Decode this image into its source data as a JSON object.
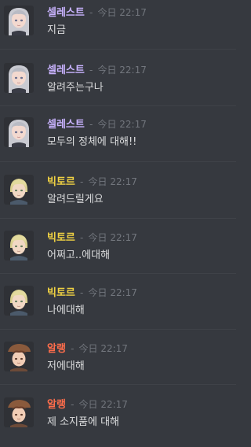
{
  "colors": {
    "background": "#36393f",
    "celeste_name": "#c9b3ff",
    "victor_name": "#f0d243",
    "alang_name": "#ff6d4b",
    "timestamp": "#72767d",
    "message_text": "#dcddde"
  },
  "messages": [
    {
      "name": "셀레스트",
      "sep": "-",
      "time": "今日 22:17",
      "text": "지금",
      "avatar": "celeste-avatar"
    },
    {
      "name": "셀레스트",
      "sep": "-",
      "time": "今日 22:17",
      "text": "알려주는구나",
      "avatar": "celeste-avatar"
    },
    {
      "name": "셀레스트",
      "sep": "-",
      "time": "今日 22:17",
      "text": "모두의 정체에 대해!!",
      "avatar": "celeste-avatar"
    },
    {
      "name": "빅토르",
      "sep": "-",
      "time": "今日 22:17",
      "text": "알려드릴게요",
      "avatar": "victor-avatar"
    },
    {
      "name": "빅토르",
      "sep": "-",
      "time": "今日 22:17",
      "text": "어쩌고..에대해",
      "avatar": "victor-avatar"
    },
    {
      "name": "빅토르",
      "sep": "-",
      "time": "今日 22:17",
      "text": "나에대해",
      "avatar": "victor-avatar"
    },
    {
      "name": "알랭",
      "sep": "-",
      "time": "今日 22:17",
      "text": "저에대해",
      "avatar": "alang-avatar"
    },
    {
      "name": "알랭",
      "sep": "-",
      "time": "今日 22:17",
      "text": "제 소지품에 대해",
      "avatar": "alang-avatar"
    }
  ]
}
